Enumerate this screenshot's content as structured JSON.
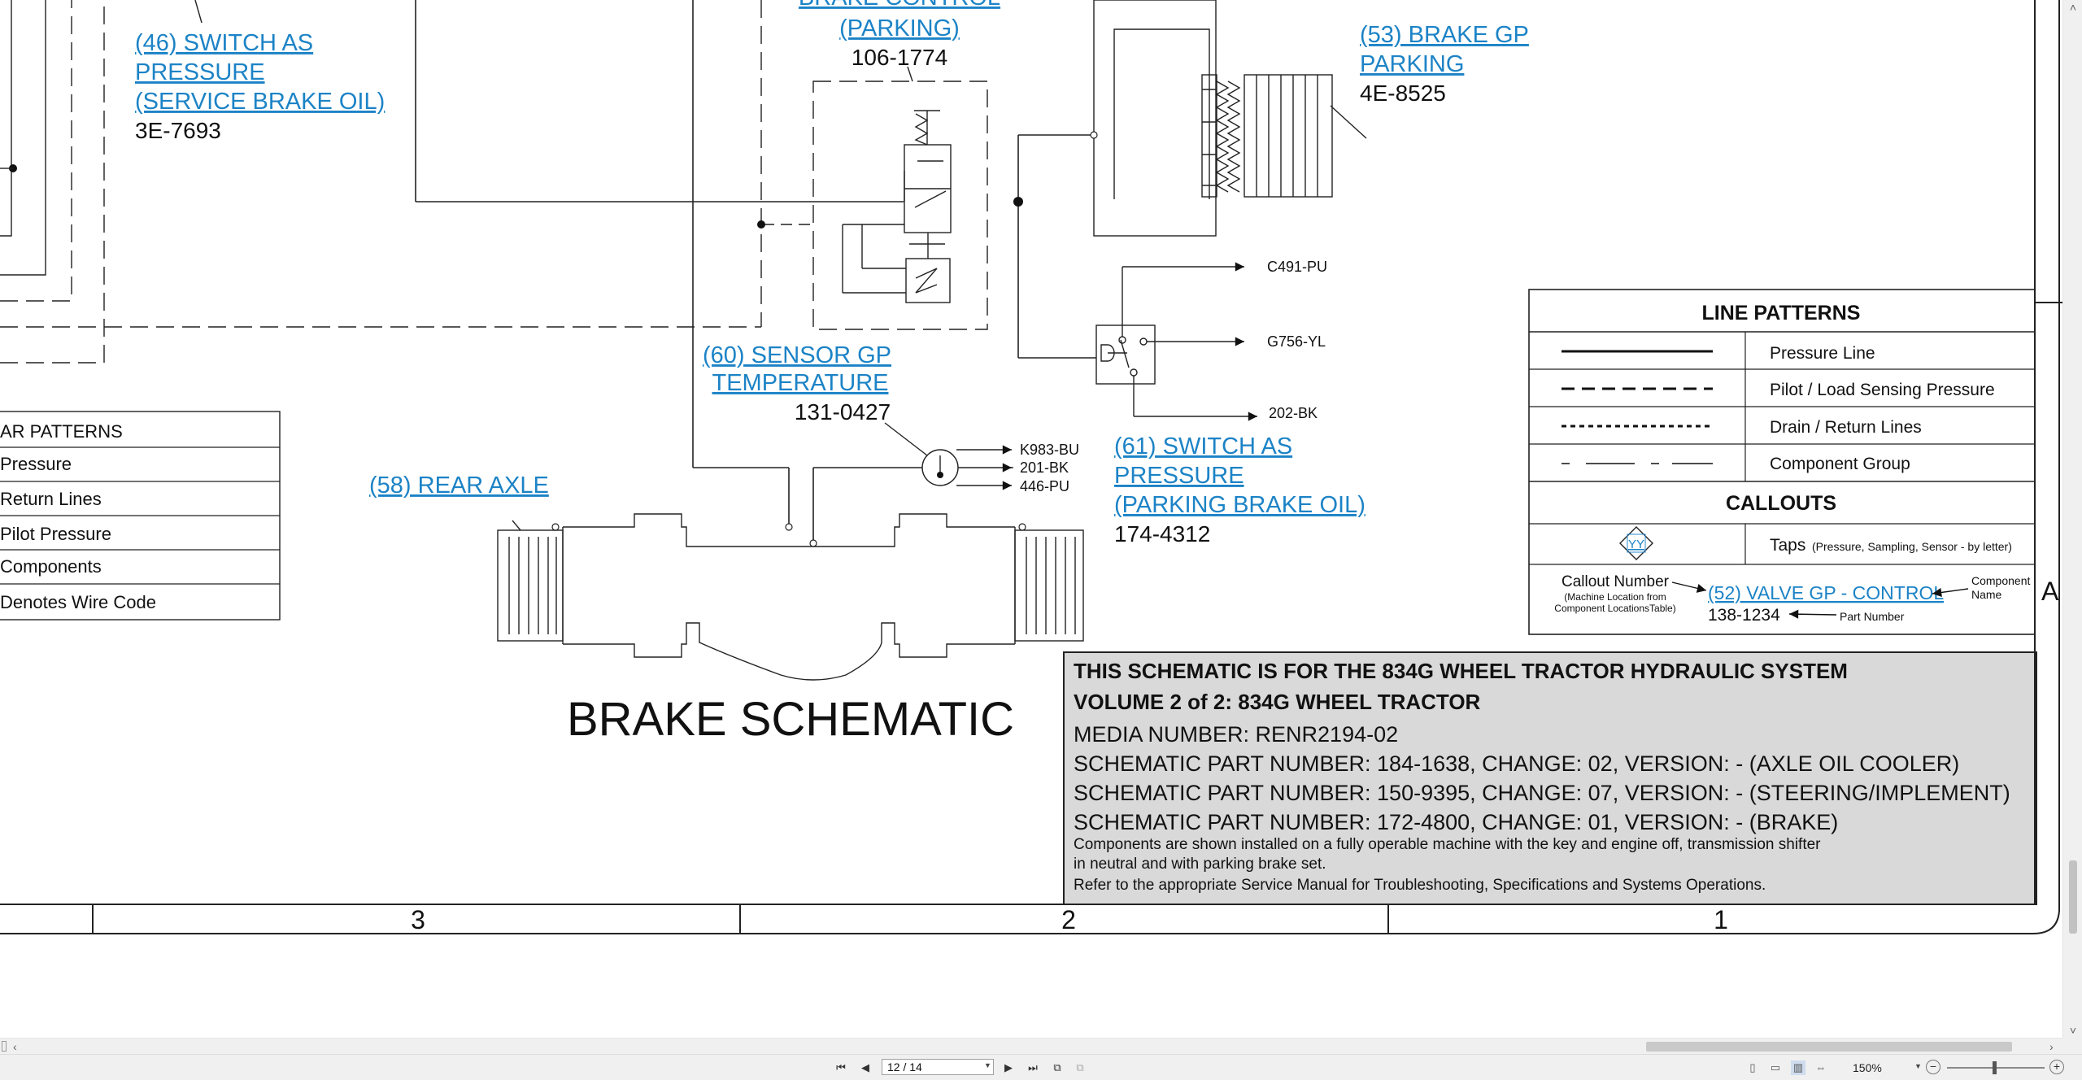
{
  "schematic": {
    "title": "BRAKE SCHEMATIC",
    "components": [
      {
        "callout": [
          "(46) SWITCH AS",
          "PRESSURE",
          "(SERVICE BRAKE OIL)"
        ],
        "part": "3E-7693"
      },
      {
        "callout": [
          "BRAKE CONTROL",
          "(PARKING)"
        ],
        "part": "106-1774"
      },
      {
        "callout": [
          "(53) BRAKE GP",
          "PARKING"
        ],
        "part": "4E-8525"
      },
      {
        "callout": [
          "(60) SENSOR GP",
          "TEMPERATURE"
        ],
        "part": "131-0427"
      },
      {
        "callout": [
          "(58) REAR AXLE"
        ],
        "part": ""
      },
      {
        "callout": [
          "(61) SWITCH AS",
          "PRESSURE",
          "(PARKING BRAKE OIL)"
        ],
        "part": "174-4312"
      }
    ],
    "wire_codes": [
      "C491-PU",
      "G756-YL",
      "202-BK",
      "K983-BU",
      "201-BK",
      "446-PU"
    ],
    "left_legend": {
      "title": "AR PATTERNS",
      "rows": [
        "Pressure",
        "Return Lines",
        " Pilot Pressure",
        "Components",
        " Denotes Wire Code"
      ]
    },
    "line_patterns": {
      "title": "LINE PATTERNS",
      "rows": [
        "Pressure Line",
        "Pilot / Load Sensing Pressure",
        "Drain / Return Lines",
        "Component Group"
      ]
    },
    "callouts": {
      "title": "CALLOUTS",
      "tap_marker": "YY",
      "taps_label": "Taps",
      "taps_note": "(Pressure, Sampling, Sensor - by letter)",
      "callout_number": "Callout Number",
      "callout_number_note1": "(Machine Location from",
      "callout_number_note2": "Component LocationsTable)",
      "example_callout": "(52) VALVE GP - CONTROL",
      "example_part": "138-1234",
      "component_name": [
        "Component",
        "Name"
      ],
      "part_number_label": "Part Number"
    },
    "info_box": {
      "line1": "THIS SCHEMATIC IS FOR THE 834G WHEEL TRACTOR HYDRAULIC SYSTEM",
      "line2": "VOLUME 2 of 2: 834G WHEEL TRACTOR",
      "line3": "MEDIA NUMBER: RENR2194-02",
      "line4": "SCHEMATIC PART NUMBER: 184-1638, CHANGE: 02, VERSION: - (AXLE OIL COOLER)",
      "line5": "SCHEMATIC PART NUMBER: 150-9395, CHANGE: 07, VERSION: - (STEERING/IMPLEMENT)",
      "line6": "SCHEMATIC PART NUMBER: 172-4800, CHANGE: 01, VERSION: - (BRAKE)",
      "line7": "Components are shown installed on a fully operable machine with the key and engine off, transmission shifter",
      "line8": "in neutral and with parking brake set.",
      "line9": "Refer to the appropriate Service Manual for Troubleshooting, Specifications and Systems Operations."
    },
    "zone_numbers": [
      "3",
      "2",
      "1"
    ],
    "zone_letter": "A"
  },
  "viewer": {
    "page_field": "12 / 14",
    "zoom": "150%",
    "icons": [
      "first-page-icon",
      "prev-page-icon",
      "next-page-icon",
      "last-page-icon",
      "copy-icon",
      "paste-icon",
      "single-page-view-icon",
      "continuous-view-icon",
      "two-page-view-icon",
      "fit-width-icon",
      "zoom-out-icon",
      "zoom-in-icon"
    ]
  }
}
